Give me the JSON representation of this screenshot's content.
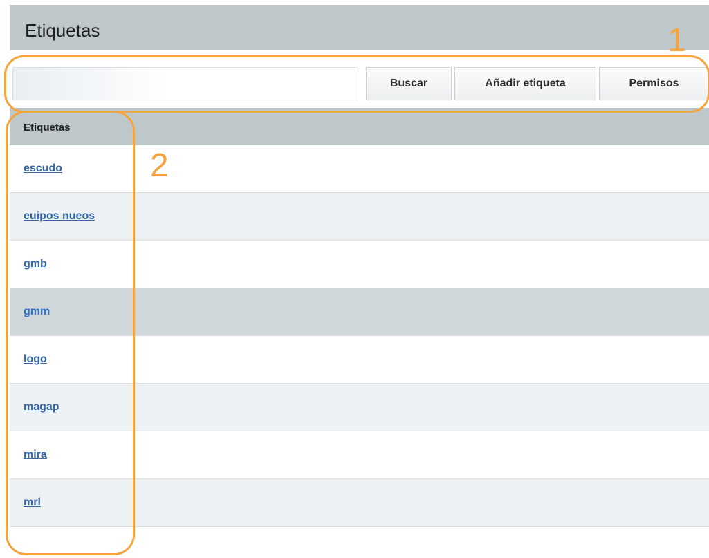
{
  "header": {
    "title": "Etiquetas"
  },
  "toolbar": {
    "search_value": "",
    "search_placeholder": "",
    "search_button": "Buscar",
    "add_button": "Añadir etiqueta",
    "permissions_button": "Permisos"
  },
  "table": {
    "column_header": "Etiquetas",
    "rows": [
      {
        "label": "escudo"
      },
      {
        "label": "euipos nueos"
      },
      {
        "label": "gmb"
      },
      {
        "label": "gmm"
      },
      {
        "label": "logo"
      },
      {
        "label": "magap"
      },
      {
        "label": "mira"
      },
      {
        "label": "mrl"
      }
    ]
  },
  "annotations": {
    "callout_1": "1",
    "callout_2": "2",
    "color": "#f5a33c"
  },
  "colors": {
    "header_bg": "#bec8cb",
    "link": "#3366aa",
    "selected_row": "#d0d8db",
    "alt_row": "#eef1f3"
  }
}
